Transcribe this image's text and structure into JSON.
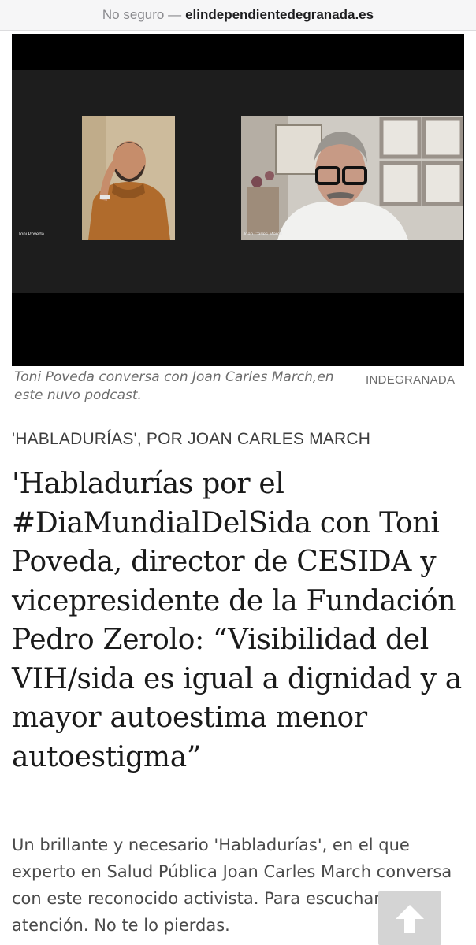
{
  "browser": {
    "security_label": "No seguro —",
    "domain": "elindependientedegranada.es"
  },
  "video": {
    "participant_left": "Toni Poveda",
    "participant_right": "Joan Carles March"
  },
  "figure": {
    "caption": "Toni Poveda conversa con Joan Carles March,en este nuvo podcast.",
    "credit": "INDEGRANADA"
  },
  "article": {
    "kicker": "'HABLADURÍAS', POR JOAN CARLES MARCH",
    "headline": "'Habladurías por el #DiaMundialDelSida con Toni Poveda, director de CESIDA y vicepresidente de la Fundación Pedro Zerolo: “Visibilidad del VIH/sida es igual a dignidad y a mayor autoestima menor autoestigma”",
    "lead": "Un brillante y necesario 'Habladurías', en el que experto en Salud Pública Joan Carles March conversa con este reconocido activista. Para escuchar con atención. No te lo pierdas."
  },
  "controls": {
    "scroll_top_icon": "arrow-up-icon"
  },
  "colors": {
    "video_background": "#000000",
    "meeting_strip": "#1d1d1d",
    "scroll_button": "#d4d4d4"
  }
}
